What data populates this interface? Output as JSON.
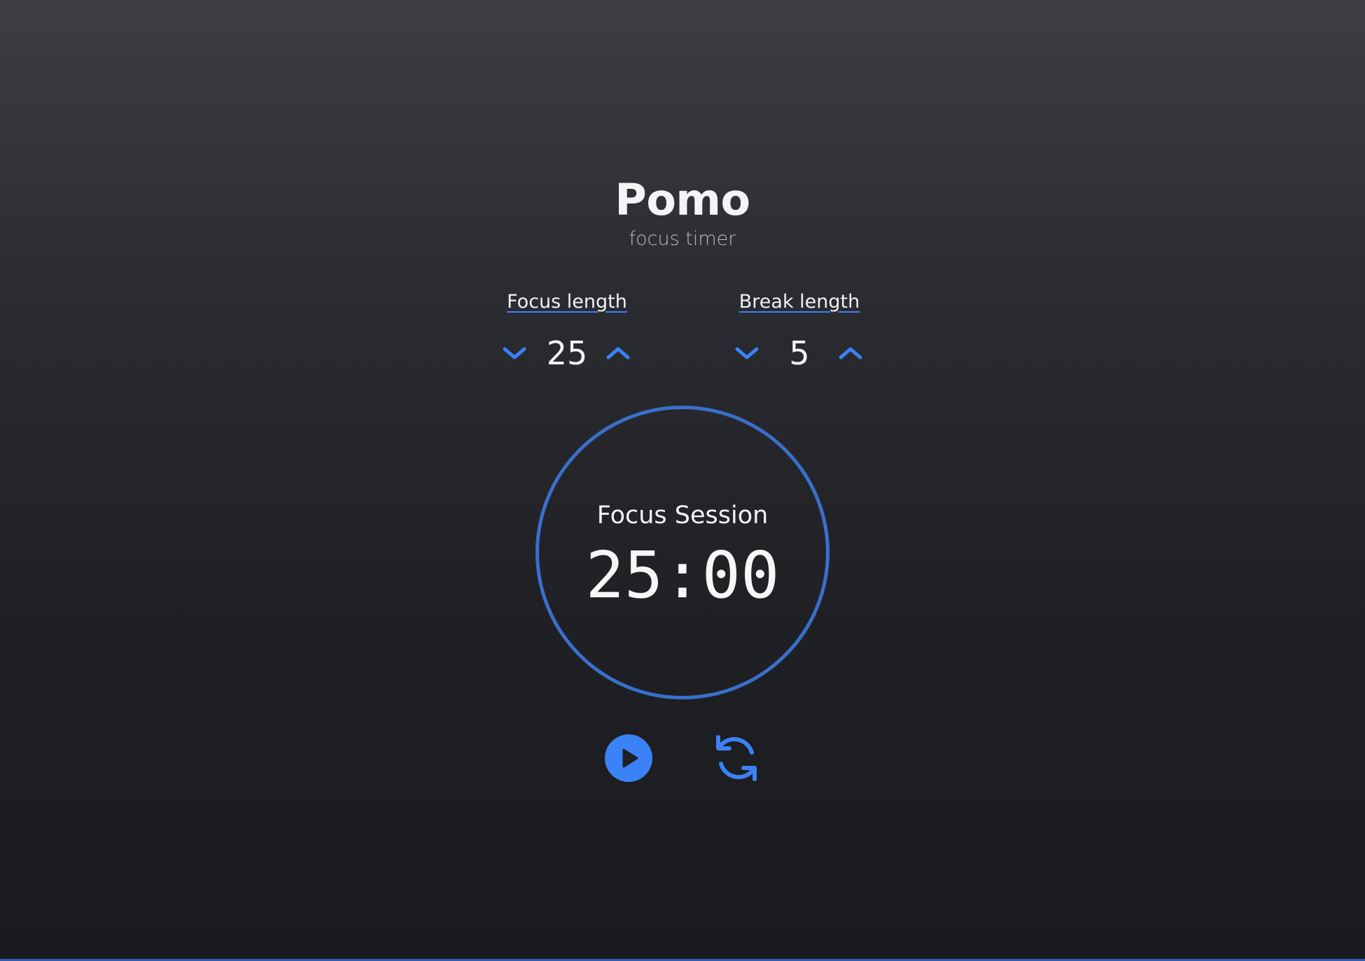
{
  "app": {
    "title": "Pomo",
    "subtitle": "focus timer"
  },
  "settings": {
    "focus": {
      "label": "Focus length",
      "value": "25",
      "decrement_icon": "chevron-down-icon",
      "increment_icon": "chevron-up-icon"
    },
    "break": {
      "label": "Break length",
      "value": "5",
      "decrement_icon": "chevron-down-icon",
      "increment_icon": "chevron-up-icon"
    }
  },
  "timer": {
    "session_label": "Focus Session",
    "time": "25:00"
  },
  "controls": {
    "play_icon": "play-circle-icon",
    "reset_icon": "refresh-icon"
  },
  "colors": {
    "accent": "#3b82f6",
    "ring": "#3a6fcb",
    "text": "#f4f4f6",
    "muted": "#b9bac0"
  }
}
